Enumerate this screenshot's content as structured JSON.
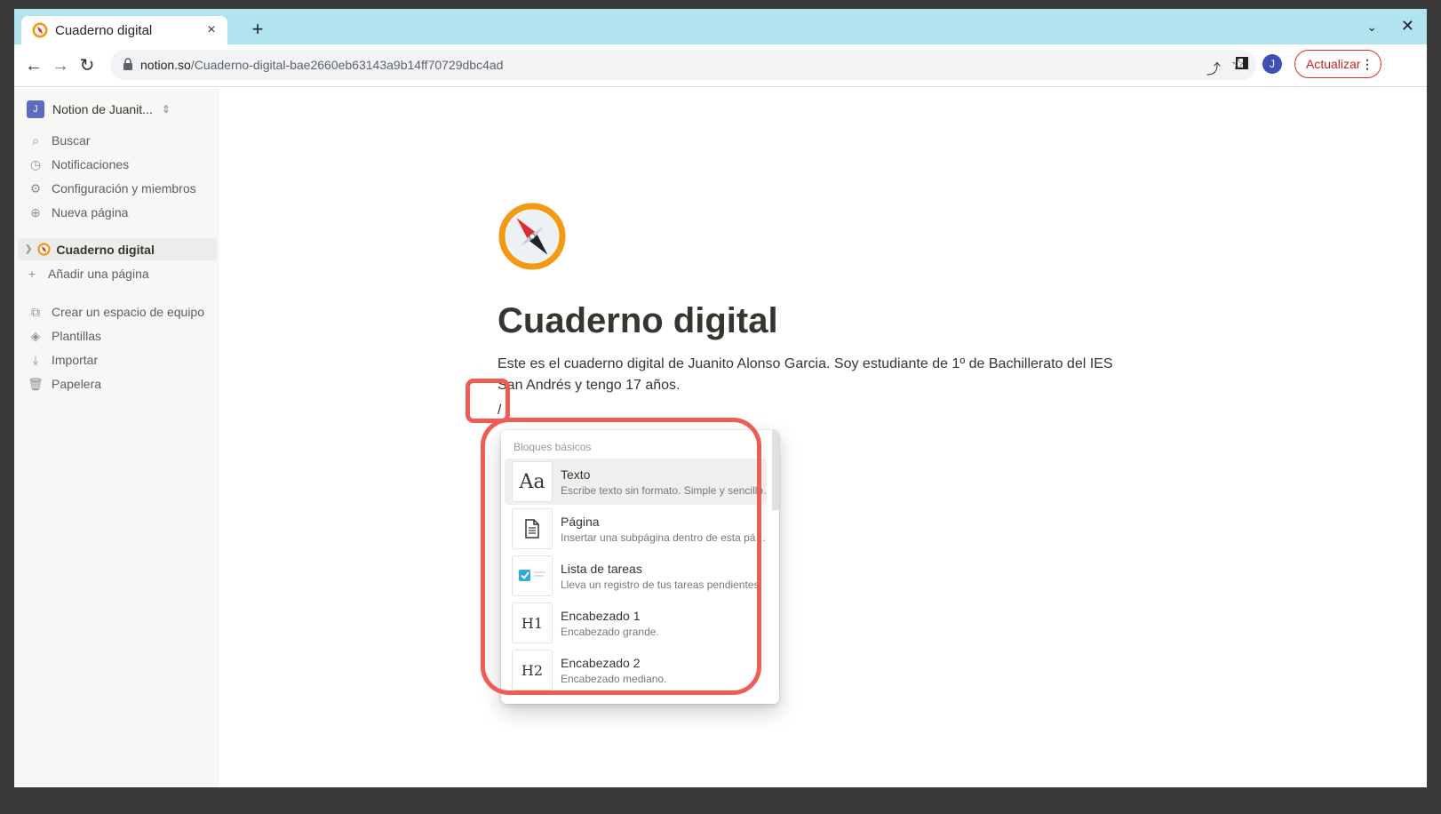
{
  "browser": {
    "tab_title": "Cuaderno digital",
    "tab_close": "×",
    "new_tab": "+",
    "window_close": "✕",
    "url_host": "notion.so",
    "url_path": "/Cuaderno-digital-bae2660eb63143a9b14ff70729dbc4ad",
    "profile_initial": "J",
    "update_label": "Actualizar",
    "menu_dots": "⋮"
  },
  "sidebar": {
    "workspace_initial": "J",
    "workspace_name": "Notion de Juanit...",
    "items": [
      {
        "label": "Buscar",
        "icon": "search-icon"
      },
      {
        "label": "Notificaciones",
        "icon": "clock-icon"
      },
      {
        "label": "Configuración y miembros",
        "icon": "gear-icon"
      },
      {
        "label": "Nueva página",
        "icon": "plus-circle-icon"
      }
    ],
    "page": {
      "label": "Cuaderno digital",
      "icon": "compass-icon"
    },
    "add_page": "Añadir una página",
    "bottom": [
      {
        "label": "Crear un espacio de equipo",
        "icon": "team-icon"
      },
      {
        "label": "Plantillas",
        "icon": "templates-icon"
      },
      {
        "label": "Importar",
        "icon": "download-icon"
      },
      {
        "label": "Papelera",
        "icon": "trash-icon"
      }
    ]
  },
  "page": {
    "title": "Cuaderno digital",
    "body": "Este es el cuaderno digital de Juanito Alonso Garcia. Soy estudiante de 1º de Bachillerato del IES San Andrés y tengo 17 años.",
    "slash_input": "/"
  },
  "slash_menu": {
    "section": "Bloques básicos",
    "items": [
      {
        "name": "Texto",
        "desc": "Escribe texto sin formato. Simple y sencillo.",
        "thumb": "Aa",
        "icon": "text-icon"
      },
      {
        "name": "Página",
        "desc": "Insertar una subpágina dentro de esta página.",
        "thumb": "",
        "icon": "page-icon"
      },
      {
        "name": "Lista de tareas",
        "desc": "Lleva un registro de tus tareas pendientes.",
        "thumb": "",
        "icon": "todo-icon"
      },
      {
        "name": "Encabezado 1",
        "desc": "Encabezado grande.",
        "thumb": "H1",
        "icon": "heading1-icon"
      },
      {
        "name": "Encabezado 2",
        "desc": "Encabezado mediano.",
        "thumb": "H2",
        "icon": "heading2-icon"
      }
    ]
  },
  "colors": {
    "tabstrip": "#b2e4ef",
    "annotation": "#f15b55",
    "text": "#37352f",
    "sidebar_bg": "#f7f7f5"
  }
}
